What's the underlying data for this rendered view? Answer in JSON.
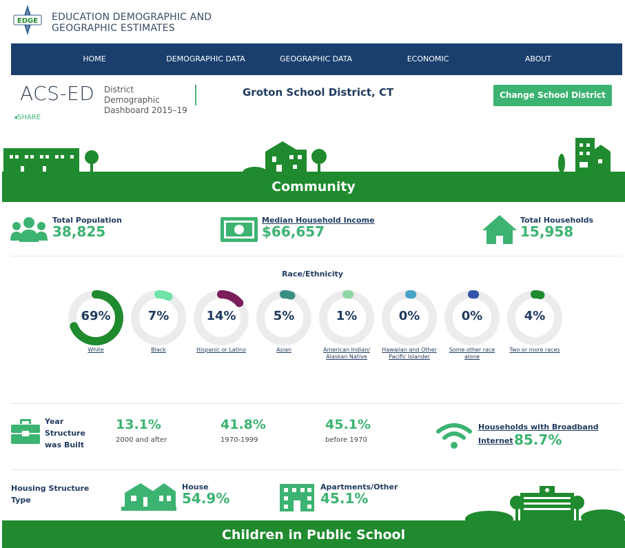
{
  "header": {
    "logo_text": "EDGE",
    "site_title_line1": "EDUCATION DEMOGRAPHIC AND",
    "site_title_line2": "GEOGRAPHIC ESTIMATES"
  },
  "nav": {
    "items": [
      "HOME",
      "DEMOGRAPHIC DATA",
      "GEOGRAPHIC DATA",
      "ECONOMIC",
      "ABOUT"
    ]
  },
  "title_row": {
    "acs": "ACS-ED",
    "dashboard_line1": "District Demographic",
    "dashboard_line2": "Dashboard 2015–19",
    "district": "Groton School District, CT",
    "change_button": "Change School District",
    "share": "SHARE"
  },
  "community": {
    "band_title": "Community",
    "total_population_label": "Total Population",
    "total_population_value": "38,825",
    "median_income_label": "Median Household Income",
    "median_income_value": "$66,657",
    "total_households_label": "Total Households",
    "total_households_value": "15,958"
  },
  "race": {
    "title": "Race/Ethnicity",
    "groups": [
      {
        "label": "White",
        "pct": "69%",
        "value": 69,
        "color": "#1f8a2e"
      },
      {
        "label": "Black",
        "pct": "7%",
        "value": 7,
        "color": "#6fe3a5"
      },
      {
        "label": "Hispanic or Latino",
        "pct": "14%",
        "value": 14,
        "color": "#7b1e5a"
      },
      {
        "label": "Asian",
        "pct": "5%",
        "value": 5,
        "color": "#3a8f85"
      },
      {
        "label": "American Indian/ Alaskan Native",
        "pct": "1%",
        "value": 1,
        "color": "#8fd6a6"
      },
      {
        "label": "Hawaiian and Other Pacific Islander",
        "pct": "0%",
        "value": 0,
        "color": "#4aa3c9"
      },
      {
        "label": "Some other race alone",
        "pct": "0%",
        "value": 0,
        "color": "#3355aa"
      },
      {
        "label": "Two or more races",
        "pct": "4%",
        "value": 4,
        "color": "#1f8a2e"
      }
    ]
  },
  "year_built": {
    "label": "Year Structure was Built",
    "items": [
      {
        "value": "13.1%",
        "sub": "2000 and after"
      },
      {
        "value": "41.8%",
        "sub": "1970-1999"
      },
      {
        "value": "45.1%",
        "sub": "before 1970"
      }
    ],
    "broadband_label_line1": "Households with Broadband",
    "broadband_label_line2": "Internet",
    "broadband_value": "85.7%"
  },
  "housing": {
    "label": "Housing Structure Type",
    "house_label": "House",
    "house_value": "54.9%",
    "apartments_label": "Apartments/Other",
    "apartments_value": "45.1%"
  },
  "children": {
    "band_title": "Children in Public School"
  },
  "colors": {
    "nav": "#1a3f6e",
    "green_band": "#1f8a2e",
    "accent_green": "#3cb371",
    "text_navy": "#1f3a5f"
  }
}
